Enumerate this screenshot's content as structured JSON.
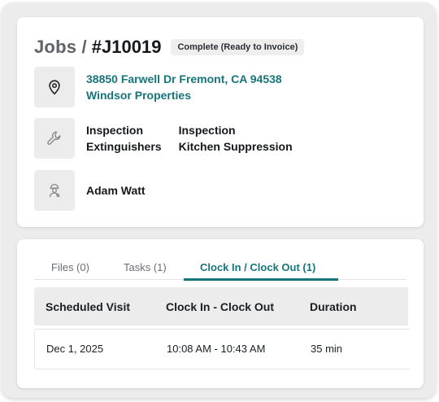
{
  "header": {
    "prefix": "Jobs /",
    "job_id": "#J10019",
    "status_badge": "Complete (Ready to Invoice)"
  },
  "location": {
    "icon": "map-pin-icon",
    "address": "38850 Farwell Dr Fremont, CA 94538",
    "customer": "Windsor Properties"
  },
  "services": {
    "icon": "wrench-icon",
    "columns": [
      {
        "line1": "Inspection",
        "line2": "Extinguishers"
      },
      {
        "line1": "Inspection",
        "line2": "Kitchen Suppression"
      }
    ]
  },
  "technician": {
    "icon": "technician-icon",
    "name": "Adam Watt"
  },
  "tabs": [
    {
      "label": "Files (0)",
      "active": false
    },
    {
      "label": "Tasks (1)",
      "active": false
    },
    {
      "label": "Clock In / Clock Out (1)",
      "active": true
    }
  ],
  "table": {
    "headers": [
      "Scheduled Visit",
      "Clock In - Clock Out",
      "Duration"
    ],
    "rows": [
      [
        "Dec 1, 2025",
        "10:08 AM - 10:43 AM",
        "35 min"
      ]
    ]
  },
  "colors": {
    "accent": "#17757a",
    "icon_bg": "#ececec",
    "badge_bg": "#eeeeef"
  }
}
